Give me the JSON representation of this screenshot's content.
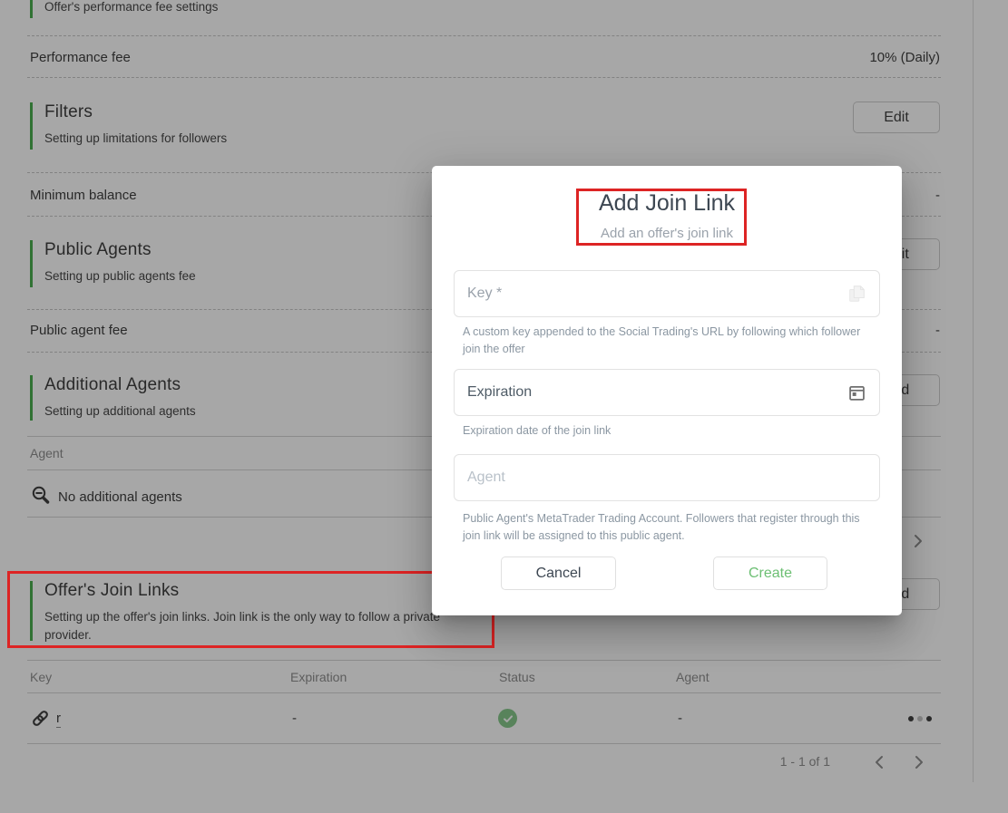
{
  "page": {
    "top_section": {
      "subtitle": "Offer's performance fee settings"
    },
    "rows": {
      "performance_fee": {
        "label": "Performance fee",
        "value": "10% (Daily)"
      },
      "minimum_balance": {
        "label": "Minimum balance",
        "value": "-"
      },
      "public_agent_fee": {
        "label": "Public agent fee",
        "value": "-"
      }
    },
    "sections": {
      "filters": {
        "title": "Filters",
        "subtitle": "Setting up limitations for followers",
        "button": "Edit"
      },
      "public_agents": {
        "title": "Public Agents",
        "subtitle": "Setting up public agents fee",
        "button": "Edit"
      },
      "additional_agents": {
        "title": "Additional Agents",
        "subtitle": "Setting up additional agents",
        "button": "Add"
      },
      "join_links": {
        "title": "Offer's Join Links",
        "subtitle": "Setting up the offer's join links. Join link is the only way to follow a private provider.",
        "button": "Add"
      }
    },
    "additional_agents_table": {
      "header": "Agent",
      "empty_text": "No additional agents"
    },
    "join_links_table": {
      "headers": [
        "Key",
        "Expiration",
        "Status",
        "Agent"
      ],
      "row": {
        "key": "r",
        "expiration": "-",
        "status": "active",
        "agent": "-"
      },
      "pagination": "1 - 1 of 1"
    }
  },
  "modal": {
    "title": "Add Join Link",
    "subtitle": "Add an offer's join link",
    "fields": {
      "key": {
        "label": "Key *",
        "helper": "A custom key appended to the Social Trading's URL by following which follower join the offer"
      },
      "expiration": {
        "label": "Expiration",
        "helper": "Expiration date of the join link"
      },
      "agent": {
        "placeholder": "Agent",
        "helper": "Public Agent's MetaTrader Trading Account. Followers that register through this join link will be assigned to this public agent."
      }
    },
    "buttons": {
      "cancel": "Cancel",
      "create": "Create"
    }
  },
  "colors": {
    "accent_green": "#4caf50",
    "create_green": "#6cbf73",
    "status_green": "#87c98c",
    "annotation_red": "#dd2424"
  }
}
